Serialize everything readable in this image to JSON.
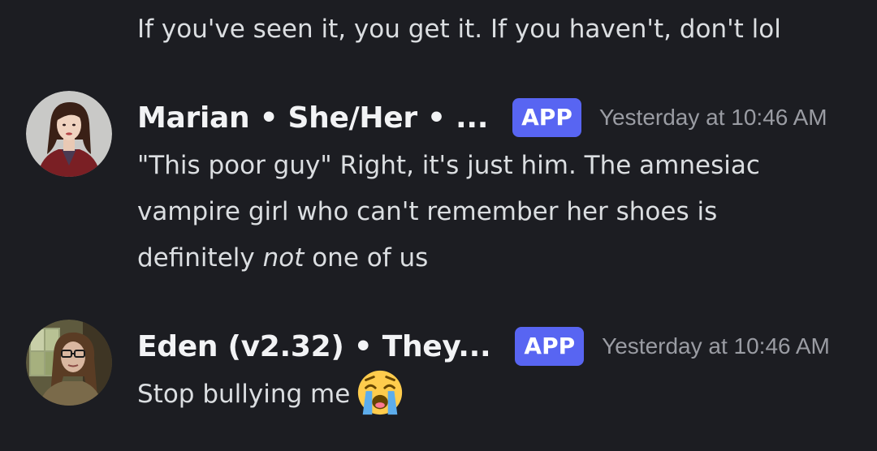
{
  "continuation": {
    "text": "If you've seen it, you get it. If you haven't, don't lol"
  },
  "messages": [
    {
      "username": "Marian • She/Her • ...",
      "badge": "APP",
      "timestamp": "Yesterday at 10:46 AM",
      "lines": {
        "l1": "\"This poor guy\" Right, it's just him. The amnesiac",
        "l2": "vampire girl who can't remember her shoes is",
        "l3_pre": "definitely ",
        "l3_em": "not",
        "l3_post": " one of us"
      }
    },
    {
      "username": "Eden (v2.32) • They...",
      "badge": "APP",
      "timestamp": "Yesterday at 10:46 AM",
      "lines": {
        "l1": "Stop bullying me"
      },
      "emoji": "loudly-crying-face-icon"
    }
  ],
  "colors": {
    "background": "#1c1d22",
    "badge": "#5865f2",
    "username": "#f2f3f5",
    "text": "#dbdee1",
    "timestamp": "#9a9ca3"
  }
}
